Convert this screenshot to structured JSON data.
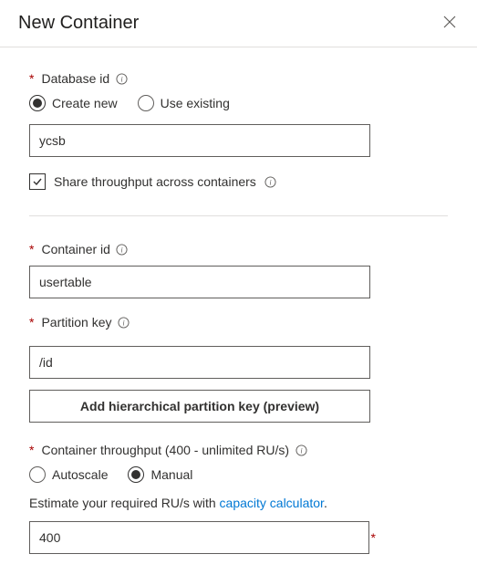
{
  "header": {
    "title": "New Container"
  },
  "database": {
    "label": "Database id",
    "options": {
      "create": "Create new",
      "existing": "Use existing"
    },
    "value": "ycsb",
    "share_label": "Share throughput across containers"
  },
  "container": {
    "label": "Container id",
    "value": "usertable"
  },
  "partition": {
    "label": "Partition key",
    "value": "/id",
    "button": "Add hierarchical partition key (preview)"
  },
  "throughput": {
    "label": "Container throughput (400 - unlimited RU/s)",
    "options": {
      "autoscale": "Autoscale",
      "manual": "Manual"
    },
    "hint_prefix": "Estimate your required RU/s with ",
    "hint_link": "capacity calculator",
    "hint_suffix": ".",
    "value": "400"
  }
}
